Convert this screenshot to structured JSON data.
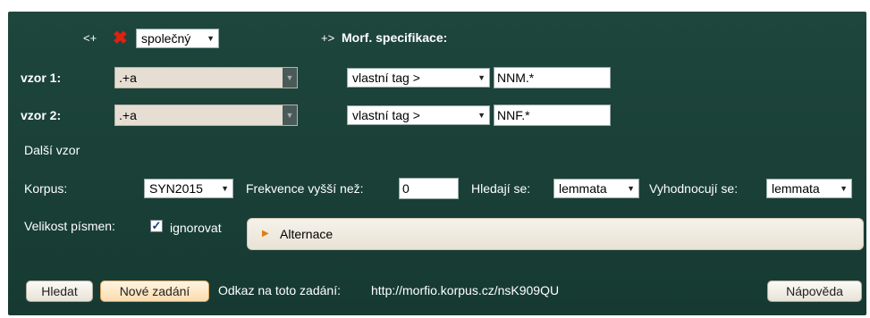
{
  "row0": {
    "prev_link": "<+",
    "remove_icon": "red-x-icon",
    "type_select": "společný",
    "next_link": "+>",
    "morf_heading": "Morf. specifikace:"
  },
  "patterns": [
    {
      "label": "vzor 1:",
      "value": ".+a",
      "tag_select": "vlastní tag >",
      "tag_value": "NNM.*"
    },
    {
      "label": "vzor 2:",
      "value": ".+a",
      "tag_select": "vlastní tag >",
      "tag_value": "NNF.*"
    }
  ],
  "another_pattern": "Další vzor",
  "settings": {
    "corpus_label": "Korpus:",
    "corpus_value": "SYN2015",
    "freq_label": "Frekvence vyšší než:",
    "freq_value": "0",
    "search_label": "Hledají se:",
    "search_value": "lemmata",
    "eval_label": "Vyhodnocují se:",
    "eval_value": "lemmata"
  },
  "case": {
    "label": "Velikost písmen:",
    "checked": true,
    "checkbox_label": "ignorovat"
  },
  "alternace": "Alternace",
  "footer": {
    "search_button": "Hledat",
    "new_button": "Nové zadání",
    "link_label": "Odkaz na toto zadání:",
    "link_url": "http://morfio.korpus.cz/nsK909QU",
    "help_button": "Nápověda"
  },
  "colors": {
    "panel_bg": "#1e463d",
    "accent_orange": "#e07b10",
    "remove_red": "#e02010"
  }
}
